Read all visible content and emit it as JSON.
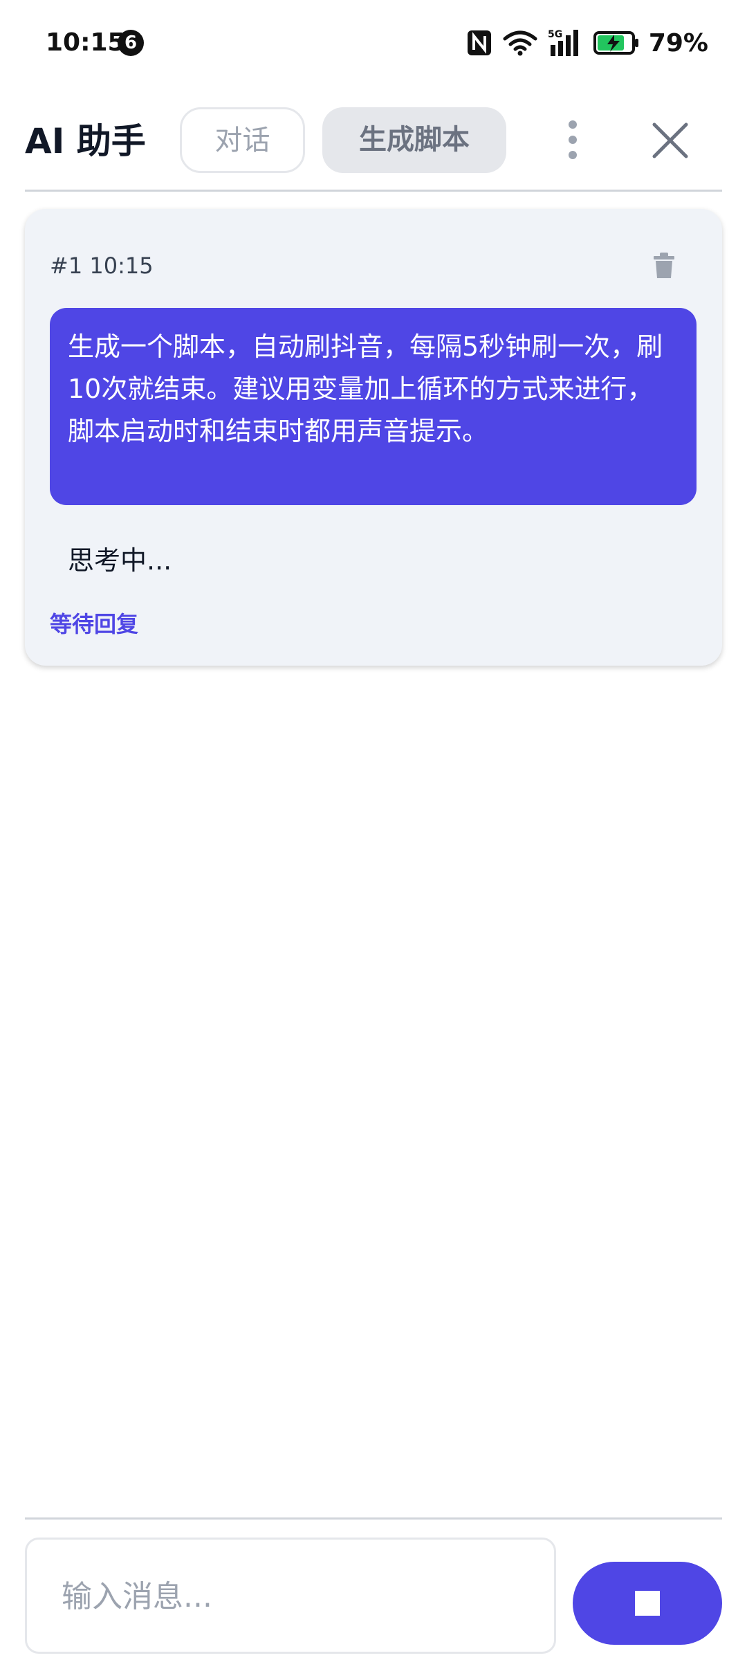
{
  "status_bar": {
    "time": "10:15",
    "notification_count": "6",
    "battery": "79%",
    "network": "5G"
  },
  "header": {
    "title": "AI 助手",
    "tabs": [
      {
        "label": "对话",
        "active": false
      },
      {
        "label": "生成脚本",
        "active": true
      }
    ]
  },
  "conversation": {
    "meta": "#1 10:15",
    "user_message": "生成一个脚本，自动刷抖音，每隔5秒钟刷一次，刷10次就结束。建议用变量加上循环的方式来进行，脚本启动时和结束时都用声音提示。",
    "assistant_status": "思考中...",
    "state_label": "等待回复"
  },
  "composer": {
    "placeholder": "输入消息...",
    "value": ""
  },
  "colors": {
    "accent": "#4f46e5",
    "card_bg": "#f0f3f8",
    "divider": "#d1d5db"
  }
}
